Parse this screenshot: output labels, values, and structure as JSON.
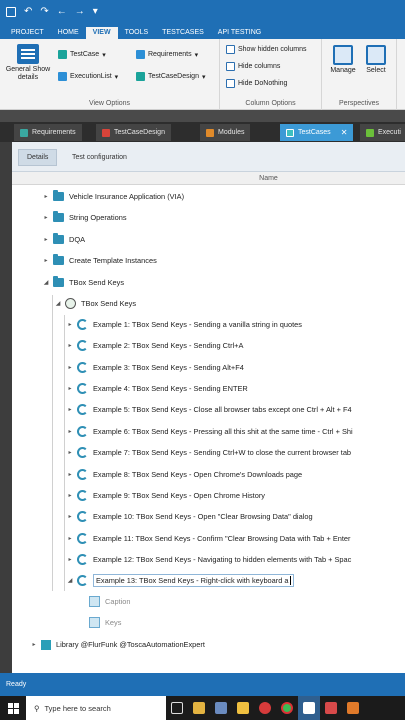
{
  "ribbon_tabs": [
    "PROJECT",
    "HOME",
    "VIEW",
    "TOOLS",
    "TESTCASES",
    "API TESTING"
  ],
  "ribbon": {
    "view_options": {
      "big_button": "General Show details",
      "small": [
        "TestCase",
        "ExecutionList",
        "Requirements",
        "TestCaseDesign"
      ],
      "label": "View Options"
    },
    "column_options": {
      "items": [
        "Show hidden columns",
        "Hide columns",
        "Hide DoNothing"
      ],
      "label": "Column Options"
    },
    "perspectives": {
      "buttons": [
        "Manage",
        "Select"
      ],
      "label": "Perspectives"
    }
  },
  "workspace_tabs": [
    "Requirements",
    "TestCaseDesign",
    "Modules",
    "TestCases",
    "Executi"
  ],
  "detail_tabs": [
    "Details",
    "Test configuration"
  ],
  "column_header": "Name",
  "tree": {
    "folders": [
      "Vehicle Insurance Application (VIA)",
      "String Operations",
      "DQA",
      "Create Template Instances",
      "TBox Send Keys"
    ],
    "tbox_node": "TBox Send Keys",
    "examples": [
      "Example 1: TBox Send Keys - Sending a vanilla string in quotes",
      "Example 2: TBox Send Keys - Sending Ctrl+A",
      "Example 3: TBox Send Keys - Sending Alt+F4",
      "Example 4: TBox Send Keys - Sending ENTER",
      "Example 5: TBox Send Keys - Close all browser tabs except one Ctrl + Alt + F4",
      "Example 6: TBox Send Keys - Pressing all this shit at the same time - Ctrl + Shi",
      "Example 7: TBox Send Keys - Sending Ctrl+W to close the current browser tab",
      "Example 8: TBox Send Keys - Open Chrome's Downloads page",
      "Example 9: TBox Send Keys - Open Chrome History",
      "Example 10: TBox Send Keys - Open \"Clear Browsing Data\" dialog",
      "Example 11: TBox Send Keys - Confirm \"Clear Browsing Data with Tab + Enter",
      "Example 12: TBox Send Keys - Navigating to hidden elements with Tab + Spac",
      "Example 13: TBox Send Keys - Right-click with keyboard a"
    ],
    "children": [
      "Caption",
      "Keys"
    ],
    "library": "Library @FlurFunk @ToscaAutomationExpert"
  },
  "status_text": "Ready",
  "taskbar": {
    "search_placeholder": "Type here to search"
  }
}
